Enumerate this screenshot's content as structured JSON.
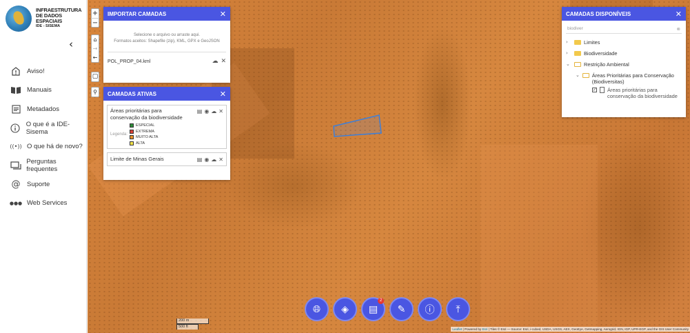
{
  "logo": {
    "line1": "INFRAESTRUTURA",
    "line2": "DE DADOS ESPACIAIS",
    "line3": "IDE - SISEMA"
  },
  "sidebar": {
    "items": [
      {
        "label": "Aviso!",
        "icon": "warning-icon"
      },
      {
        "label": "Manuais",
        "icon": "book-icon"
      },
      {
        "label": "Metadados",
        "icon": "document-icon"
      },
      {
        "label": "O que é a IDE-Sisema",
        "icon": "info-icon"
      },
      {
        "label": "O que há de novo?",
        "icon": "broadcast-icon"
      },
      {
        "label": "Perguntas frequentes",
        "icon": "faq-icon"
      },
      {
        "label": "Suporte",
        "icon": "at-icon"
      },
      {
        "label": "Web Services",
        "icon": "dots-icon"
      }
    ]
  },
  "import_panel": {
    "title": "IMPORTAR CAMADAS",
    "drop_line1": "Selecione o arquivo ou arraste aqui.",
    "drop_line2": "Formatos aceitos: Shapefile (zip), KML, GPX e GeoJSON",
    "file_name": "POL_PROP_04.kml"
  },
  "active_panel": {
    "title": "CAMADAS ATIVAS",
    "layer1_name": "Áreas prioritárias para conservação da biodiversidade",
    "legend_label": "Legenda:",
    "legend": [
      {
        "label": "ESPECIAL",
        "color": "#2e8b3a"
      },
      {
        "label": "EXTREMA",
        "color": "#d9433a"
      },
      {
        "label": "MUITO ALTA",
        "color": "#e8902a"
      },
      {
        "label": "ALTA",
        "color": "#f2e24a"
      }
    ],
    "layer2_name": "Limite de Minas Gerais"
  },
  "avail_panel": {
    "title": "CAMADAS DISPONÍVEIS",
    "search_value": "biodiver",
    "tree": {
      "limites": "Limites",
      "biodiversidade": "Biodiversidade",
      "restricao": "Restrição Ambiental",
      "areas_folder": "Áreas Prioritárias para Conservação (Biodiversitas)",
      "areas_layer": "Áreas prioritárias para conservação da biodiversidade"
    }
  },
  "toolbar": {
    "badge_count": "2"
  },
  "scale": {
    "metric": "200 m",
    "imperial": "500 ft"
  },
  "attribution": {
    "leaflet": "Leaflet",
    "powered": " | Powered by ",
    "esri": "Esri",
    "rest": " | Tiles © Esri — Source: Esri, i-cubed, USDA, USGS, AEX, GeoEye, Getmapping, Aerogrid, IGN, IGP, UPR-EGP, and the GIS User Community"
  },
  "colors": {
    "accent": "#4a56e2",
    "polygon_stroke": "#3d7fd9"
  }
}
